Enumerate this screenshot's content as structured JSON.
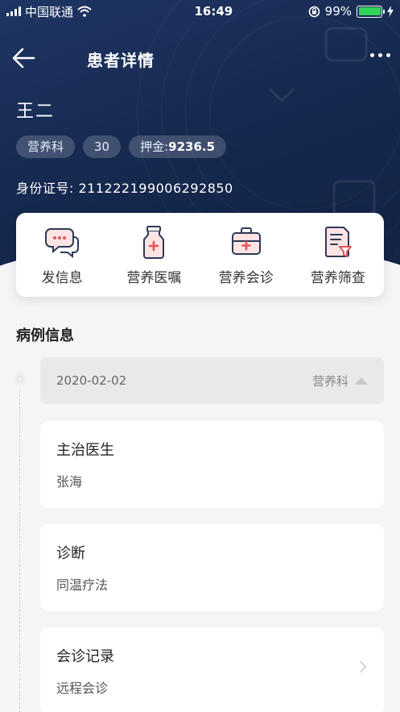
{
  "status_bar": {
    "carrier": "中国联通",
    "time": "16:49",
    "battery": "99%"
  },
  "nav": {
    "title": "患者详情"
  },
  "patient": {
    "name": "王二",
    "tags": [
      "营养科",
      "30"
    ],
    "deposit_label": "押金:",
    "deposit_value": "9236.5",
    "id_label": "身份证号:",
    "id_number": "211222199006292850"
  },
  "actions": [
    {
      "label": "发信息",
      "icon": "message-bubbles-icon"
    },
    {
      "label": "营养医嘱",
      "icon": "medicine-bottle-icon"
    },
    {
      "label": "营养会诊",
      "icon": "medical-kit-icon"
    },
    {
      "label": "营养筛查",
      "icon": "screening-document-icon"
    }
  ],
  "case_info": {
    "title": "病例信息",
    "record": {
      "date": "2020-02-02",
      "department": "营养科"
    },
    "cards": [
      {
        "label": "主治医生",
        "value": "张海"
      },
      {
        "label": "诊断",
        "value": "同温疗法"
      },
      {
        "label": "会诊记录",
        "value": "远程会诊"
      }
    ]
  },
  "colors": {
    "header_bg": "#1b2f59",
    "accent_red": "#e8535a",
    "icon_outline": "#2c3a55"
  }
}
